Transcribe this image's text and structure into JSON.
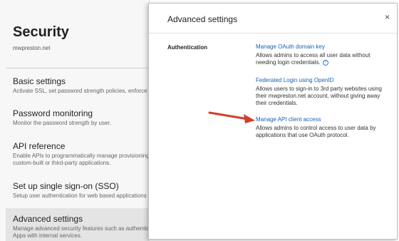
{
  "left_page": {
    "title": "Security",
    "domain": "mwpreston.net",
    "menu": [
      {
        "title": "Basic settings",
        "desc": "Activate SSL, set password strength policies, enforce"
      },
      {
        "title": "Password monitoring",
        "desc": "Monitor the password strength by user."
      },
      {
        "title": "API reference",
        "desc": "Enable APIs to programmatically manage provisioning",
        "desc2": "custom-built or third-party applications."
      },
      {
        "title": "Set up single sign-on (SSO)",
        "desc": "Setup user authentication for web based applications"
      },
      {
        "title": "Advanced settings",
        "desc": "Manage advanced security features such as authentic",
        "desc2": "Apps with internal services."
      }
    ]
  },
  "dialog": {
    "title": "Advanced settings",
    "close_label": "×",
    "section_label": "Authentication",
    "settings": [
      {
        "link": "Manage OAuth domain key",
        "desc1": "Allows admins to access all user data without",
        "desc2": "needing login credentials.",
        "help_icon": "help-circle-icon"
      },
      {
        "link": "Federated Login using OpenID",
        "desc1": "Allows users to sign-in to 3rd party websites using",
        "desc2": "their mwpreston.net account, without giving away",
        "desc3": "their credentials."
      },
      {
        "link": "Manage API client access",
        "desc1": "Allows admins to control access to user data by",
        "desc2": "applications that use OAuth protocol."
      }
    ]
  },
  "annotation": {
    "icon": "red-arrow-icon",
    "color": "#d0402b"
  },
  "colors": {
    "link": "#1a5fb4",
    "active_item_bg": "#e4e4e4"
  }
}
